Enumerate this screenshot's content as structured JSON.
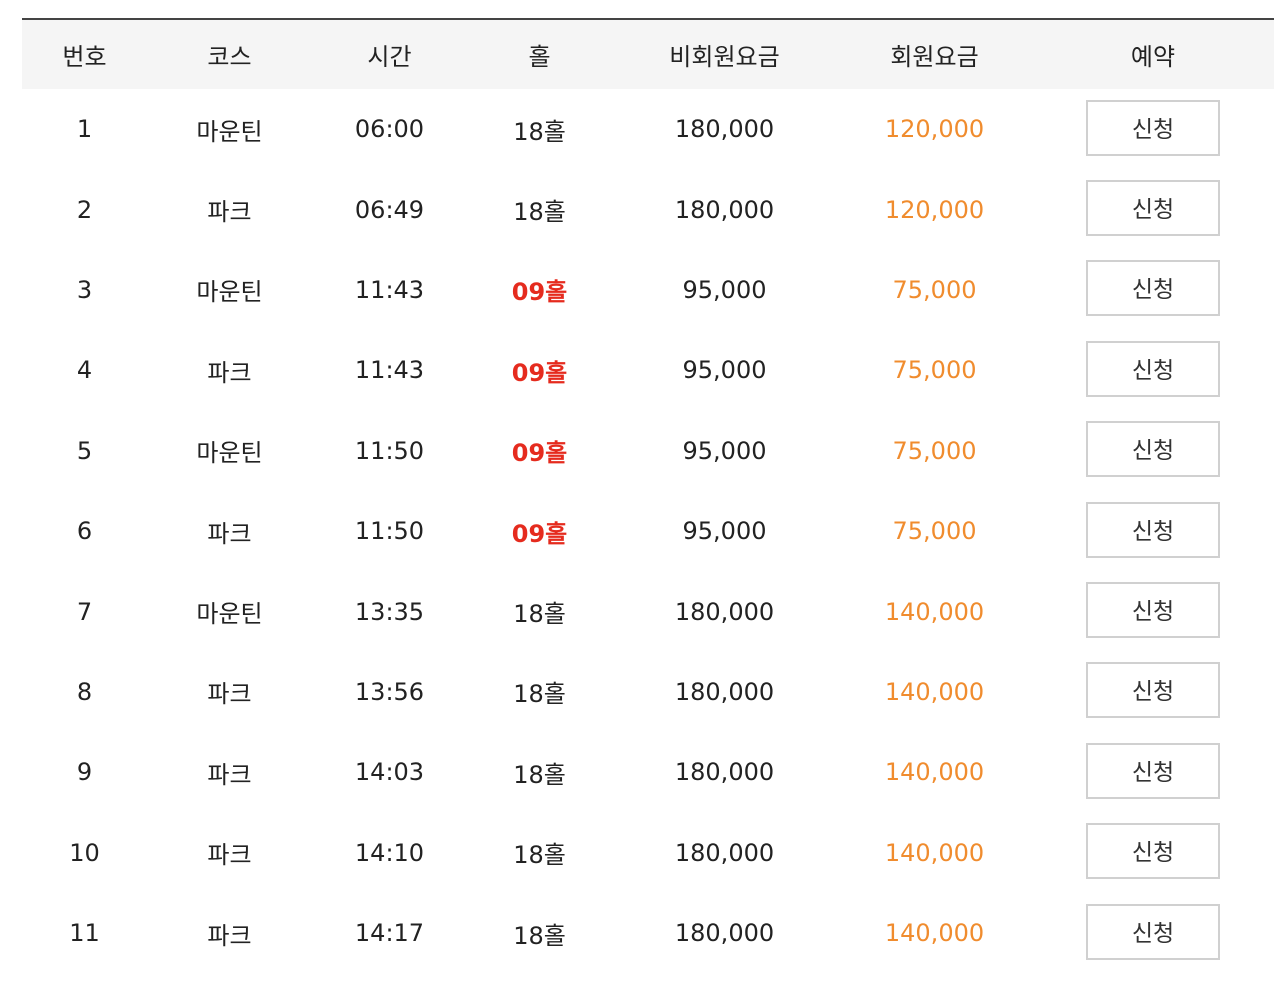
{
  "table": {
    "headers": [
      "번호",
      "코스",
      "시간",
      "홀",
      "비회원요금",
      "회원요금",
      "예약"
    ],
    "apply_label": "신청",
    "colors": {
      "header_bg": "#f5f5f5",
      "header_border": "#444444",
      "short_holes_red": "#e52b1e",
      "member_price_orange": "#f08c2e"
    },
    "rows": [
      {
        "no": "1",
        "course": "마운틴",
        "time": "06:00",
        "holes": "18홀",
        "short": false,
        "nonmember": "180,000",
        "member": "120,000"
      },
      {
        "no": "2",
        "course": "파크",
        "time": "06:49",
        "holes": "18홀",
        "short": false,
        "nonmember": "180,000",
        "member": "120,000"
      },
      {
        "no": "3",
        "course": "마운틴",
        "time": "11:43",
        "holes": "09홀",
        "short": true,
        "nonmember": "95,000",
        "member": "75,000"
      },
      {
        "no": "4",
        "course": "파크",
        "time": "11:43",
        "holes": "09홀",
        "short": true,
        "nonmember": "95,000",
        "member": "75,000"
      },
      {
        "no": "5",
        "course": "마운틴",
        "time": "11:50",
        "holes": "09홀",
        "short": true,
        "nonmember": "95,000",
        "member": "75,000"
      },
      {
        "no": "6",
        "course": "파크",
        "time": "11:50",
        "holes": "09홀",
        "short": true,
        "nonmember": "95,000",
        "member": "75,000"
      },
      {
        "no": "7",
        "course": "마운틴",
        "time": "13:35",
        "holes": "18홀",
        "short": false,
        "nonmember": "180,000",
        "member": "140,000"
      },
      {
        "no": "8",
        "course": "파크",
        "time": "13:56",
        "holes": "18홀",
        "short": false,
        "nonmember": "180,000",
        "member": "140,000"
      },
      {
        "no": "9",
        "course": "파크",
        "time": "14:03",
        "holes": "18홀",
        "short": false,
        "nonmember": "180,000",
        "member": "140,000"
      },
      {
        "no": "10",
        "course": "파크",
        "time": "14:10",
        "holes": "18홀",
        "short": false,
        "nonmember": "180,000",
        "member": "140,000"
      },
      {
        "no": "11",
        "course": "파크",
        "time": "14:17",
        "holes": "18홀",
        "short": false,
        "nonmember": "180,000",
        "member": "140,000"
      }
    ]
  }
}
